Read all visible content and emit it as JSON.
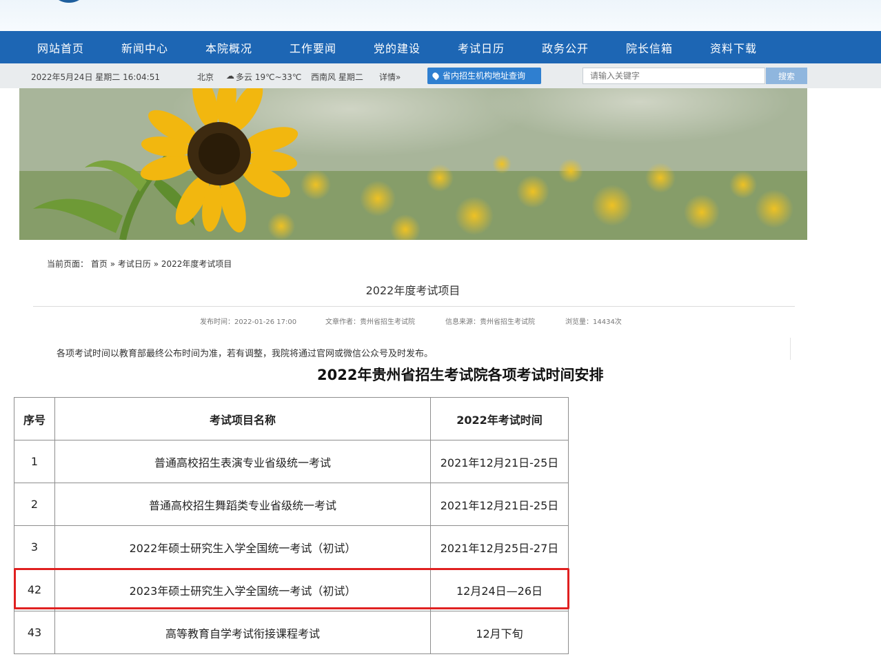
{
  "nav": {
    "items": [
      "网站首页",
      "新闻中心",
      "本院概况",
      "工作要闻",
      "党的建设",
      "考试日历",
      "政务公开",
      "院长信箱",
      "资料下载"
    ]
  },
  "infobar": {
    "datetime": "2022年5月24日 星期二 16:04:51",
    "city": "北京",
    "weather": "多云 19℃~33℃",
    "wind": "西南风 星期二",
    "detail": "详情»",
    "address_button": "省内招生机构地址查询",
    "search_placeholder": "请输入关键字",
    "search_button": "搜索"
  },
  "breadcrumb": {
    "prefix": "当前页面：",
    "home": "首页",
    "sep1": "»",
    "category": "考试日历",
    "sep2": "»",
    "current": "2022年度考试项目"
  },
  "article": {
    "title": "2022年度考试项目",
    "publish_time": "发布时间：2022-01-26 17:00",
    "author": "文章作者：贵州省招生考试院",
    "source": "信息来源：贵州省招生考试院",
    "views": "浏览量：14434次",
    "notice": "各项考试时间以教育部最终公布时间为准，若有调整，我院将通过官网或微信公众号及时发布。",
    "table_title": "2022年贵州省招生考试院各项考试时间安排"
  },
  "table": {
    "headers": [
      "序号",
      "考试项目名称",
      "2022年考试时间"
    ],
    "rows": [
      [
        "1",
        "普通高校招生表演专业省级统一考试",
        "2021年12月21日-25日"
      ],
      [
        "2",
        "普通高校招生舞蹈类专业省级统一考试",
        "2021年12月21日-25日"
      ],
      [
        "3",
        "2022年硕士研究生入学全国统一考试（初试）",
        "2021年12月25日-27日"
      ],
      [
        "42",
        "2023年硕士研究生入学全国统一考试（初试）",
        "12月24日—26日"
      ],
      [
        "43",
        "高等教育自学考试衔接课程考试",
        "12月下旬"
      ]
    ]
  },
  "colors": {
    "nav_bg": "#1d66b4",
    "highlight": "#e02020"
  }
}
